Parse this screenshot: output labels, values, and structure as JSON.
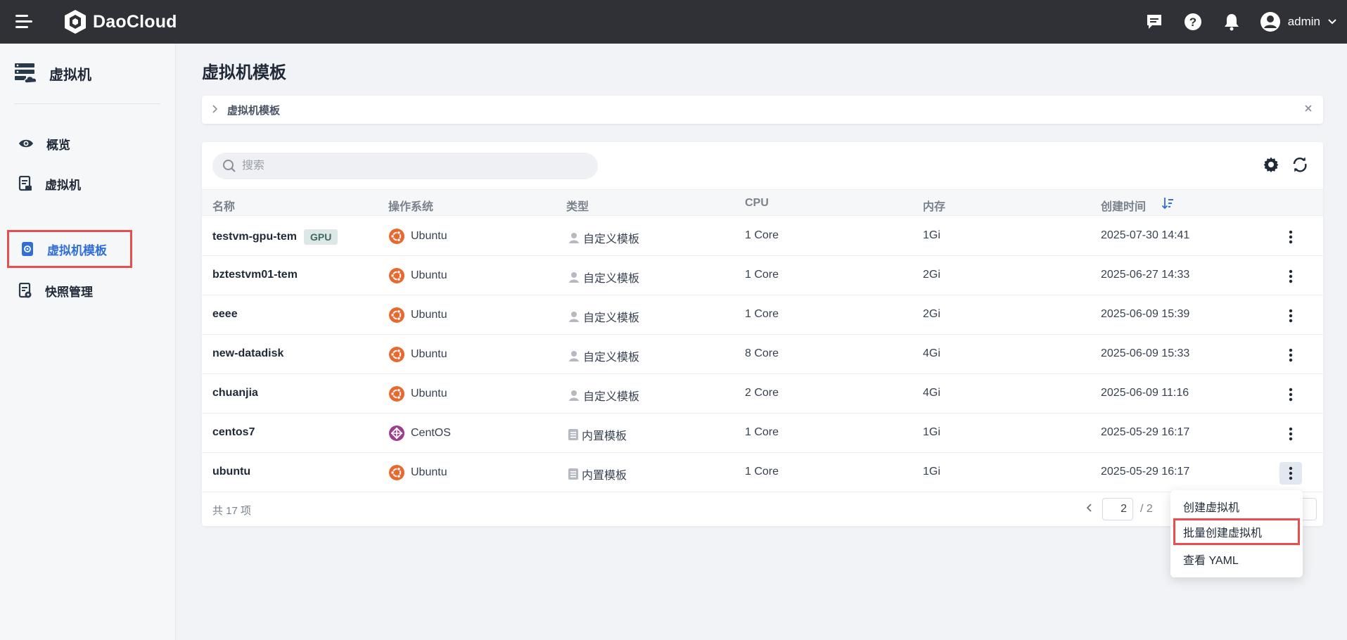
{
  "header": {
    "logo_text": "DaoCloud",
    "user_name": "admin"
  },
  "sidebar": {
    "title": "虚拟机",
    "items": [
      {
        "label": "概览",
        "icon": "eye-icon"
      },
      {
        "label": "虚拟机",
        "icon": "vm-doc-icon"
      },
      {
        "label": "虚拟机模板",
        "icon": "template-icon",
        "active": true
      },
      {
        "label": "快照管理",
        "icon": "snapshot-icon"
      }
    ]
  },
  "main": {
    "title": "虚拟机模板",
    "breadcrumb": "虚拟机模板",
    "search_placeholder": "搜索",
    "columns": [
      "名称",
      "操作系统",
      "类型",
      "CPU",
      "内存",
      "创建时间"
    ],
    "rows": [
      {
        "name": "testvm-gpu-tem",
        "badge": "GPU",
        "os": "Ubuntu",
        "type": "自定义模板",
        "cpu": "1 Core",
        "memory": "1Gi",
        "created": "2025-07-30 14:41"
      },
      {
        "name": "bztestvm01-tem",
        "os": "Ubuntu",
        "type": "自定义模板",
        "cpu": "1 Core",
        "memory": "2Gi",
        "created": "2025-06-27 14:33"
      },
      {
        "name": "eeee",
        "os": "Ubuntu",
        "type": "自定义模板",
        "cpu": "1 Core",
        "memory": "2Gi",
        "created": "2025-06-09 15:39"
      },
      {
        "name": "new-datadisk",
        "os": "Ubuntu",
        "type": "自定义模板",
        "cpu": "8 Core",
        "memory": "4Gi",
        "created": "2025-06-09 15:33"
      },
      {
        "name": "chuanjia",
        "os": "Ubuntu",
        "type": "自定义模板",
        "cpu": "2 Core",
        "memory": "4Gi",
        "created": "2025-06-09 11:16"
      },
      {
        "name": "centos7",
        "os": "CentOS",
        "type": "内置模板",
        "cpu": "1 Core",
        "memory": "1Gi",
        "created": "2025-05-29 16:17"
      },
      {
        "name": "ubuntu",
        "os": "Ubuntu",
        "type": "内置模板",
        "cpu": "1 Core",
        "memory": "1Gi",
        "created": "2025-05-29 16:17"
      }
    ],
    "total_text": "共 17 项",
    "page_current": "2",
    "page_total": "/ 2"
  },
  "dropdown": {
    "items": [
      "创建虚拟机",
      "批量创建虚拟机",
      "查看 YAML"
    ]
  },
  "colors": {
    "accent": "#2f6fd6",
    "highlight": "#ea4d4d",
    "ubuntu": "#e9682f",
    "centos": "#9b3f8f",
    "topbar": "#2f3136"
  }
}
